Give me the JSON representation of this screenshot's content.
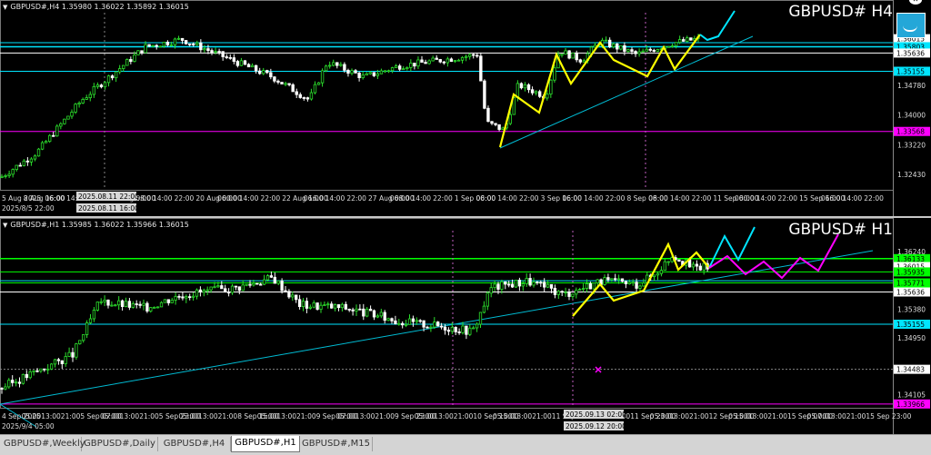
{
  "chart_data": [
    {
      "type": "candlestick",
      "symbol": "GBPUSD#",
      "timeframe": "H4",
      "header": "GBPUSD#,H4  1.35980 1.36022 1.35892 1.36015",
      "ylim": [
        1.321,
        1.367
      ],
      "y_tick_labels": [
        "1.36015",
        "1.35803",
        "1.35636",
        "1.35155",
        "1.34780",
        "1.34000",
        "1.33568",
        "1.33220",
        "1.32430"
      ],
      "x_tick_labels": [
        "5 Aug 2025",
        "8 Aug 16:00",
        "06:00",
        "14:00",
        "22:00",
        "15 Aug 08:00",
        "06:00",
        "14:00",
        "22:00",
        "20 Aug 00:00",
        "06:00",
        "14:00",
        "22:00",
        "22 Aug 16:00",
        "06:00",
        "14:00",
        "22:00",
        "27 Aug 08:00",
        "06:00",
        "14:00",
        "22:00",
        "1 Sep 00:00",
        "06:00",
        "14:00",
        "22:00",
        "3 Sep 16:00",
        "06:00",
        "14:00",
        "22:00",
        "8 Sep 08:00",
        "06:00",
        "14:00",
        "22:00",
        "11 Sep 00:00",
        "06:00",
        "14:00",
        "22:00",
        "15 Sep 16:00",
        "06:00",
        "14:00",
        "22:00"
      ],
      "crosshair_labels": {
        "time_top": "2025/8/5 22:00",
        "time_sel": "2025.08.11 22:00",
        "time_bottom": "2025.08.11 16:00"
      },
      "price_labels": [
        {
          "value": 1.36015,
          "color": "#ffffff"
        },
        {
          "value": 1.35803,
          "color": "#00e5ff"
        },
        {
          "value": 1.35636,
          "color": "#ffffff"
        },
        {
          "value": 1.35155,
          "color": "#00e5ff"
        },
        {
          "value": 1.33568,
          "color": "#ff00ff"
        }
      ],
      "levels": [
        {
          "value": 1.35803,
          "color": "#00e5ff"
        },
        {
          "value": 1.3591,
          "color": "#00e5ff"
        },
        {
          "value": 1.35636,
          "color": "#ffffff"
        },
        {
          "value": 1.35155,
          "color": "#00e5ff"
        },
        {
          "value": 1.33568,
          "color": "#ff00ff"
        }
      ],
      "colors": {
        "up": "#2ce02c",
        "down": "#ffffff",
        "zigzag": "#ffff00",
        "projection": "#00e5ff",
        "trend": "#00bcd4"
      }
    },
    {
      "type": "candlestick",
      "symbol": "GBPUSD#",
      "timeframe": "H1",
      "header": "GBPUSD#,H1  1.35985 1.36022 1.35966 1.36015",
      "ylim": [
        1.3395,
        1.3655
      ],
      "y_tick_labels": [
        "1.36240",
        "1.36133",
        "1.36015",
        "1.35935",
        "1.35771",
        "1.35636",
        "1.35380",
        "1.35155",
        "1.34950",
        "1.34483",
        "1.34105",
        "1.33966"
      ],
      "x_tick_labels": [
        "4 Sep 2025",
        "05:00",
        "13:00",
        "21:00",
        "5 Sep 07:00",
        "05:00",
        "13:00",
        "21:00",
        "5 Sep 23:00",
        "05:00",
        "13:00",
        "21:00",
        "8 Sep 15:00",
        "05:00",
        "13:00",
        "21:00",
        "9 Sep 07:00",
        "05:00",
        "13:00",
        "21:00",
        "9 Sep 23:00",
        "05:00",
        "13:00",
        "21:00",
        "10 Sep 15:00",
        "05:00",
        "13:00",
        "21:00",
        "11 Sep 07:00",
        "05:00",
        "13:00",
        "21:00",
        "11 Sep 23:00",
        "05:00",
        "13:00",
        "21:00",
        "12 Sep 15:00",
        "05:00",
        "13:00",
        "21:00",
        "15 Sep 07:00",
        "05:00",
        "13:00",
        "21:00",
        "15 Sep 23:00"
      ],
      "crosshair_labels": {
        "time_top": "2025/9/4 05:00",
        "time_sel": "2025.09.13 02:00",
        "time_bottom": "2025.09.12 20:00"
      },
      "price_labels": [
        {
          "value": 1.36133,
          "color": "#00ff00"
        },
        {
          "value": 1.36015,
          "color": "#ffffff"
        },
        {
          "value": 1.35935,
          "color": "#00ff00"
        },
        {
          "value": 1.35771,
          "color": "#00ff00"
        },
        {
          "value": 1.35636,
          "color": "#ffffff"
        },
        {
          "value": 1.35155,
          "color": "#00e5ff"
        },
        {
          "value": 1.34483,
          "color": "#ffffff"
        },
        {
          "value": 1.33966,
          "color": "#ff00ff"
        }
      ],
      "levels": [
        {
          "value": 1.36133,
          "color": "#00ff00"
        },
        {
          "value": 1.35935,
          "color": "#00ff00"
        },
        {
          "value": 1.35803,
          "color": "#00e5ff"
        },
        {
          "value": 1.35771,
          "color": "#00ff00"
        },
        {
          "value": 1.35636,
          "color": "#ffffff"
        },
        {
          "value": 1.35155,
          "color": "#00e5ff"
        },
        {
          "value": 1.34483,
          "color": "#888888"
        },
        {
          "value": 1.33966,
          "color": "#ff00ff"
        }
      ],
      "colors": {
        "up": "#2ce02c",
        "down": "#ffffff",
        "zigzag": "#ffff00",
        "projection": "#00e5ff",
        "projection2": "#ff00ff",
        "trend": "#00bcd4"
      }
    }
  ],
  "tabs": [
    {
      "label": "GBPUSD#,Weekly",
      "active": false
    },
    {
      "label": "GBPUSD#,Daily",
      "active": false
    },
    {
      "label": "GBPUSD#,H4",
      "active": false
    },
    {
      "label": "GBPUSD#,H1",
      "active": true
    },
    {
      "label": "GBPUSD#,M15",
      "active": false
    }
  ],
  "icons": {
    "chart_arrow": "triangle-down-icon",
    "widget": "smile-widget-icon",
    "close": "close-circle-icon"
  }
}
